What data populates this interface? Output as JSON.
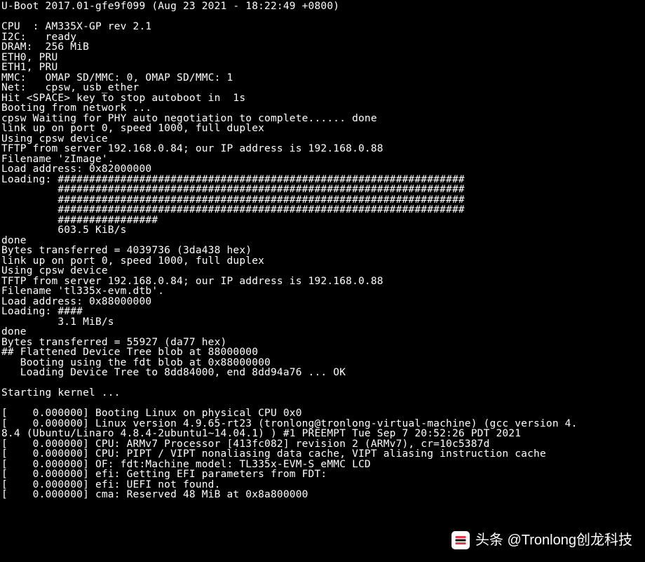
{
  "terminal": {
    "lines": [
      "U-Boot 2017.01-gfe9f099 (Aug 23 2021 - 18:22:49 +0800)",
      "",
      "CPU  : AM335X-GP rev 2.1",
      "I2C:   ready",
      "DRAM:  256 MiB",
      "ETH0, PRU",
      "ETH1, PRU",
      "MMC:   OMAP SD/MMC: 0, OMAP SD/MMC: 1",
      "Net:   cpsw, usb_ether",
      "Hit <SPACE> key to stop autoboot in  1s",
      "Booting from network ...",
      "cpsw Waiting for PHY auto negotiation to complete...... done",
      "link up on port 0, speed 1000, full duplex",
      "Using cpsw device",
      "TFTP from server 192.168.0.84; our IP address is 192.168.0.88",
      "Filename 'zImage'.",
      "Load address: 0x82000000",
      "Loading: #################################################################",
      "         #################################################################",
      "         #################################################################",
      "         #################################################################",
      "         ################",
      "         603.5 KiB/s",
      "done",
      "Bytes transferred = 4039736 (3da438 hex)",
      "link up on port 0, speed 1000, full duplex",
      "Using cpsw device",
      "TFTP from server 192.168.0.84; our IP address is 192.168.0.88",
      "Filename 'tl335x-evm.dtb'.",
      "Load address: 0x88000000",
      "Loading: ####",
      "         3.1 MiB/s",
      "done",
      "Bytes transferred = 55927 (da77 hex)",
      "## Flattened Device Tree blob at 88000000",
      "   Booting using the fdt blob at 0x88000000",
      "   Loading Device Tree to 8dd84000, end 8dd94a76 ... OK",
      "",
      "Starting kernel ...",
      "",
      "[    0.000000] Booting Linux on physical CPU 0x0",
      "[    0.000000] Linux version 4.9.65-rt23 (tronlong@tronlong-virtual-machine) (gcc version 4.",
      "8.4 (Ubuntu/Linaro 4.8.4-2ubuntu1~14.04.1) ) #1 PREEMPT Tue Sep 7 20:52:26 PDT 2021",
      "[    0.000000] CPU: ARMv7 Processor [413fc082] revision 2 (ARMv7), cr=10c5387d",
      "[    0.000000] CPU: PIPT / VIPT nonaliasing data cache, VIPT aliasing instruction cache",
      "[    0.000000] OF: fdt:Machine model: TL335x-EVM-S eMMC LCD",
      "[    0.000000] efi: Getting EFI parameters from FDT:",
      "[    0.000000] efi: UEFI not found.",
      "[    0.000000] cma: Reserved 48 MiB at 0x8a800000"
    ]
  },
  "watermark": {
    "text": "头条 @Tronlong创龙科技",
    "icon_name": "toutiao-icon"
  }
}
